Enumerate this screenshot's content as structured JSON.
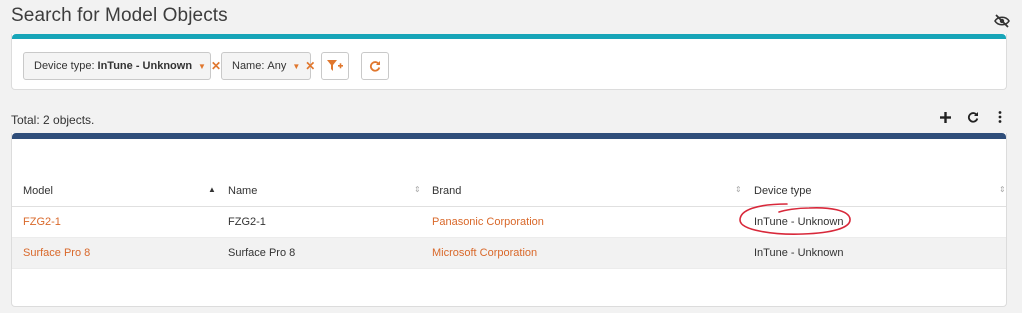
{
  "page": {
    "title": "Search for Model Objects"
  },
  "filters": {
    "device_type": {
      "label": "Device type:",
      "value": "InTune - Unknown"
    },
    "name": {
      "label": "Name:",
      "value": "Any"
    }
  },
  "results": {
    "total": "Total: 2 objects."
  },
  "table": {
    "columns": [
      "Model",
      "Name",
      "Brand",
      "Device type"
    ],
    "sorted_column": "Model",
    "sort_direction": "asc",
    "rows": [
      {
        "model": "FZG2-1",
        "name": "FZG2-1",
        "brand": "Panasonic Corporation",
        "device_type": "InTune - Unknown"
      },
      {
        "model": "Surface Pro 8",
        "name": "Surface Pro 8",
        "brand": "Microsoft Corporation",
        "device_type": "InTune - Unknown"
      }
    ]
  },
  "colors": {
    "filter_bar": "#17a5b8",
    "table_bar": "#2f4e7a",
    "link": "#d9682a",
    "annotation": "#d8283a"
  },
  "icons": {
    "hide": "eye-slash-icon",
    "add_filter": "filter-plus-icon",
    "refresh": "refresh-icon",
    "add": "plus-icon",
    "more": "vertical-ellipsis-icon"
  }
}
